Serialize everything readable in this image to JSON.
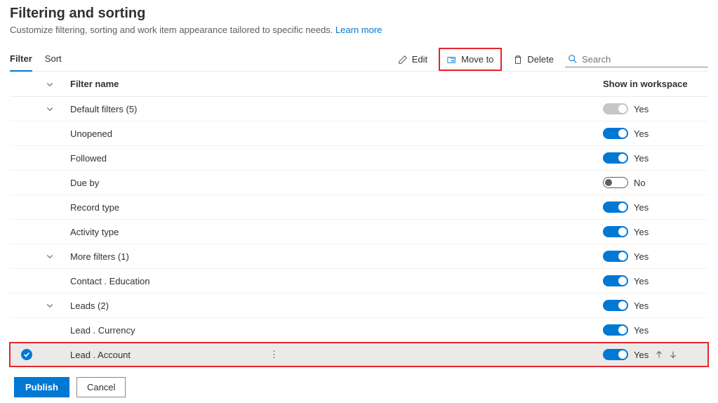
{
  "header": {
    "title": "Filtering and sorting",
    "description": "Customize filtering, sorting and work item appearance tailored to specific needs.",
    "learn_more": "Learn more"
  },
  "tabs": {
    "filter": "Filter",
    "sort": "Sort"
  },
  "toolbar": {
    "edit": "Edit",
    "move_to": "Move to",
    "delete": "Delete",
    "search_placeholder": "Search"
  },
  "columns": {
    "filter_name": "Filter name",
    "show_in_workspace": "Show in workspace"
  },
  "groups": [
    {
      "label": "Default filters (5)",
      "toggle": "disabled",
      "toggle_label": "Yes",
      "children": [
        {
          "label": "Unopened",
          "toggle": "on",
          "toggle_label": "Yes"
        },
        {
          "label": "Followed",
          "toggle": "on",
          "toggle_label": "Yes"
        },
        {
          "label": "Due by",
          "toggle": "off",
          "toggle_label": "No"
        },
        {
          "label": "Record type",
          "toggle": "on",
          "toggle_label": "Yes"
        },
        {
          "label": "Activity type",
          "toggle": "on",
          "toggle_label": "Yes"
        }
      ]
    },
    {
      "label": "More filters (1)",
      "toggle": "on",
      "toggle_label": "Yes",
      "children": [
        {
          "label": "Contact . Education",
          "toggle": "on",
          "toggle_label": "Yes"
        }
      ]
    },
    {
      "label": "Leads (2)",
      "toggle": "on",
      "toggle_label": "Yes",
      "children": [
        {
          "label": "Lead . Currency",
          "toggle": "on",
          "toggle_label": "Yes"
        },
        {
          "label": "Lead . Account",
          "toggle": "on",
          "toggle_label": "Yes",
          "selected": true
        }
      ]
    }
  ],
  "footer": {
    "publish": "Publish",
    "cancel": "Cancel"
  }
}
